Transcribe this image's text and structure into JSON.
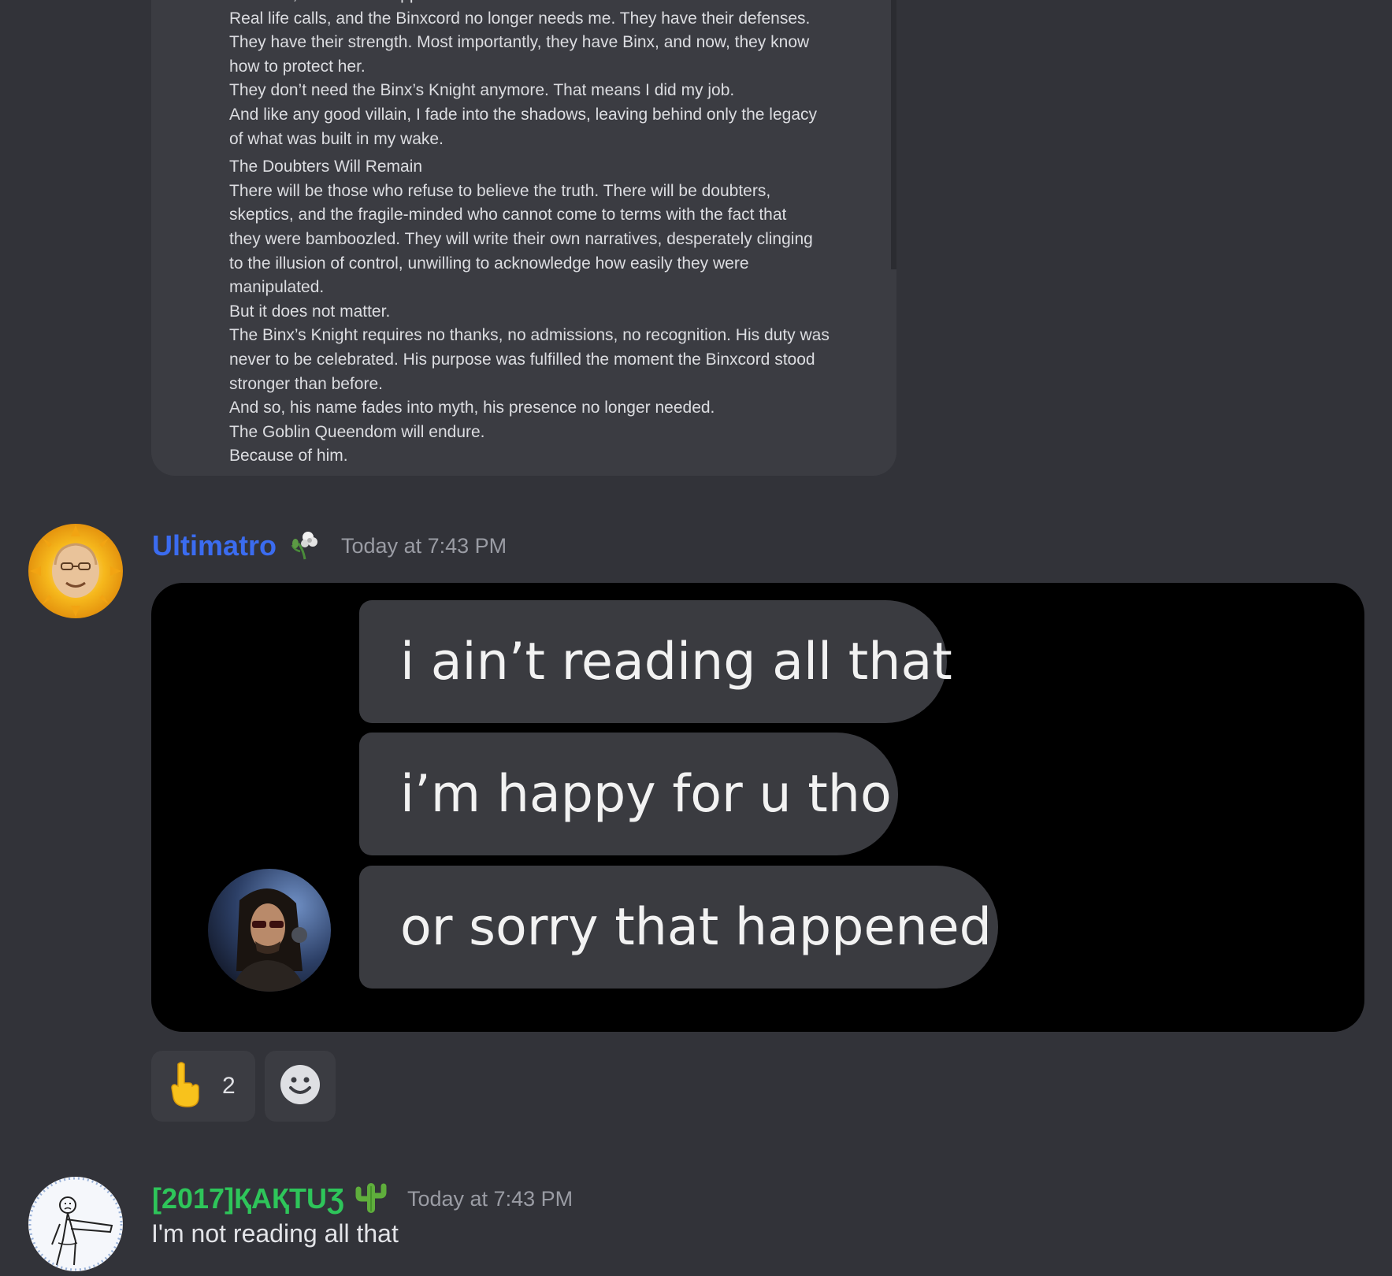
{
  "embedded_post": {
    "lines": [
      "And now, I have to disappear.",
      "Real life calls, and the Binxcord no longer needs me. They have their defenses.",
      "They have their strength. Most importantly, they have Binx, and now, they know",
      "how to protect her.",
      "They don’t need the Binx’s Knight anymore. That means I did my job.",
      "And like any good villain, I fade into the shadows, leaving behind only the legacy",
      "of what was built in my wake.",
      "The Doubters Will Remain",
      "There will be those who refuse to believe the truth. There will be doubters,",
      "skeptics, and the fragile-minded who cannot come to terms with the fact that",
      "they were bamboozled. They will write their own narratives, desperately clinging",
      "to the illusion of control, unwilling to acknowledge how easily they were",
      "manipulated.",
      "But it does not matter.",
      "The Binx’s Knight requires no thanks, no admissions, no recognition. His duty was",
      "never to be celebrated. His purpose was fulfilled the moment the Binxcord stood",
      "stronger than before.",
      "And so, his name fades into myth, his presence no longer needed.",
      "The Goblin Queendom will endure.",
      "Because of him."
    ]
  },
  "messages": [
    {
      "username": "Ultimatro",
      "username_color": "#3b6cf0",
      "badge_icon": "wilted-flower-icon",
      "timestamp": "Today at 7:43 PM",
      "avatar_icon": "sun-face-avatar",
      "meme": {
        "bubbles": [
          "i ain’t reading all that",
          "i’m happy for u tho",
          "or sorry that happened"
        ],
        "avatar_icon": "long-haired-man-avatar"
      },
      "reactions": [
        {
          "icon": "pointing-up-hand-icon",
          "count": "2"
        },
        {
          "icon": "add-reaction-smiley-icon",
          "count": ""
        }
      ]
    },
    {
      "username": "[2017]ҚAҚTUƷ",
      "username_color": "#2ec55a",
      "badge_icon": "cactus-icon",
      "timestamp": "Today at 7:43 PM",
      "avatar_icon": "sketch-figure-avatar",
      "text": "I'm not reading all that"
    }
  ],
  "colors": {
    "background": "#323339",
    "card": "#3b3c42",
    "timestamp": "#9a9ca4"
  }
}
